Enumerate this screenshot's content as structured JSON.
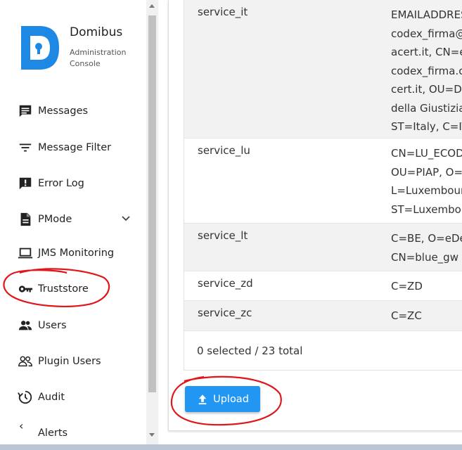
{
  "app": {
    "name": "Domibus",
    "subtitle_line1": "Administration",
    "subtitle_line2": "Console"
  },
  "sidebar": {
    "items": [
      {
        "label": "Messages",
        "icon": "message-icon"
      },
      {
        "label": "Message Filter",
        "icon": "filter-icon"
      },
      {
        "label": "Error Log",
        "icon": "alert-icon"
      },
      {
        "label": "PMode",
        "icon": "document-icon"
      },
      {
        "label": "JMS Monitoring",
        "icon": "laptop-icon"
      },
      {
        "label": "Truststore",
        "icon": "key-icon"
      },
      {
        "label": "Users",
        "icon": "users-icon"
      },
      {
        "label": "Plugin Users",
        "icon": "plugin-users-icon"
      },
      {
        "label": "Audit",
        "icon": "audit-icon"
      },
      {
        "label": "Alerts",
        "icon": "alerts-icon"
      }
    ],
    "collapse_glyph": "‹"
  },
  "table": {
    "rows": [
      {
        "alias": "service_it",
        "subject": [
          "EMAILADDRESS",
          "codex_firma@",
          "acert.it, CN=e",
          "codex_firma.c",
          "cert.it, OU=DC",
          "della Giustizia",
          "ST=Italy, C=IT"
        ]
      },
      {
        "alias": "service_lu",
        "subject": [
          "CN=LU_ECOD",
          "OU=PIAP, O=C",
          "L=Luxembour",
          "ST=Luxembou"
        ]
      },
      {
        "alias": "service_lt",
        "subject": [
          "C=BE, O=eDel",
          "CN=blue_gw"
        ]
      },
      {
        "alias": "service_zd",
        "subject": [
          "C=ZD"
        ]
      },
      {
        "alias": "service_zc",
        "subject": [
          "C=ZC"
        ]
      }
    ],
    "footer": "0 selected / 23 total"
  },
  "actions": {
    "upload_label": "Upload"
  },
  "colors": {
    "brand": "#1e88e5",
    "button": "#2196f3",
    "annotation": "#e0161b"
  }
}
